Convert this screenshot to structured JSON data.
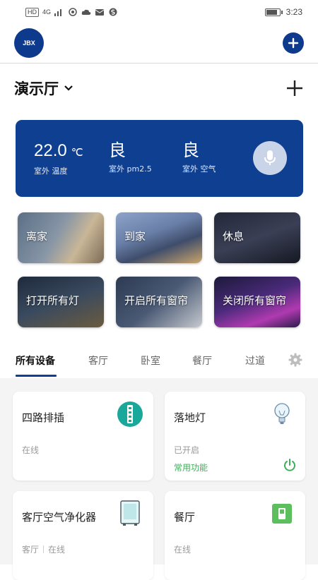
{
  "status_bar": {
    "network_chip": "HD",
    "signal_label": "4G",
    "time": "3:23",
    "battery_level": 0.85
  },
  "top_bar": {
    "logo_text": "JBX",
    "add_icon": "plus-circle-icon"
  },
  "room": {
    "name": "演示厅",
    "dropdown_icon": "chevron-down-icon",
    "add_icon": "plus-icon"
  },
  "weather": {
    "temperature_value": "22.0",
    "temperature_unit": "℃",
    "temperature_label": "室外 温度",
    "pm25_value": "良",
    "pm25_label": "室外 pm2.5",
    "air_value": "良",
    "air_label": "室外 空气",
    "mic_icon": "microphone-icon",
    "background": "#0e3f91"
  },
  "scenes": [
    {
      "label": "离家"
    },
    {
      "label": "到家"
    },
    {
      "label": "休息"
    },
    {
      "label": "打开所有灯"
    },
    {
      "label": "开启所有窗帘"
    },
    {
      "label": "关闭所有窗帘"
    }
  ],
  "tabs": [
    {
      "label": "所有设备",
      "active": true
    },
    {
      "label": "客厅"
    },
    {
      "label": "卧室"
    },
    {
      "label": "餐厅"
    },
    {
      "label": "过道"
    }
  ],
  "settings_icon": "gear-icon",
  "devices": [
    {
      "name": "四路排插",
      "status": "在线",
      "icon": "power-strip-icon"
    },
    {
      "name": "落地灯",
      "status": "已开启",
      "function": "常用功能",
      "icon": "light-bulb-icon",
      "power_icon": "power-icon"
    },
    {
      "name": "客厅空气净化器",
      "room": "客厅",
      "status": "在线",
      "icon": "air-purifier-icon"
    },
    {
      "name": "餐厅",
      "status": "在线",
      "icon": "switch-icon"
    }
  ],
  "colors": {
    "brand_blue": "#0e3f91",
    "active_green": "#3fae5a",
    "teal": "#1aa89a"
  }
}
